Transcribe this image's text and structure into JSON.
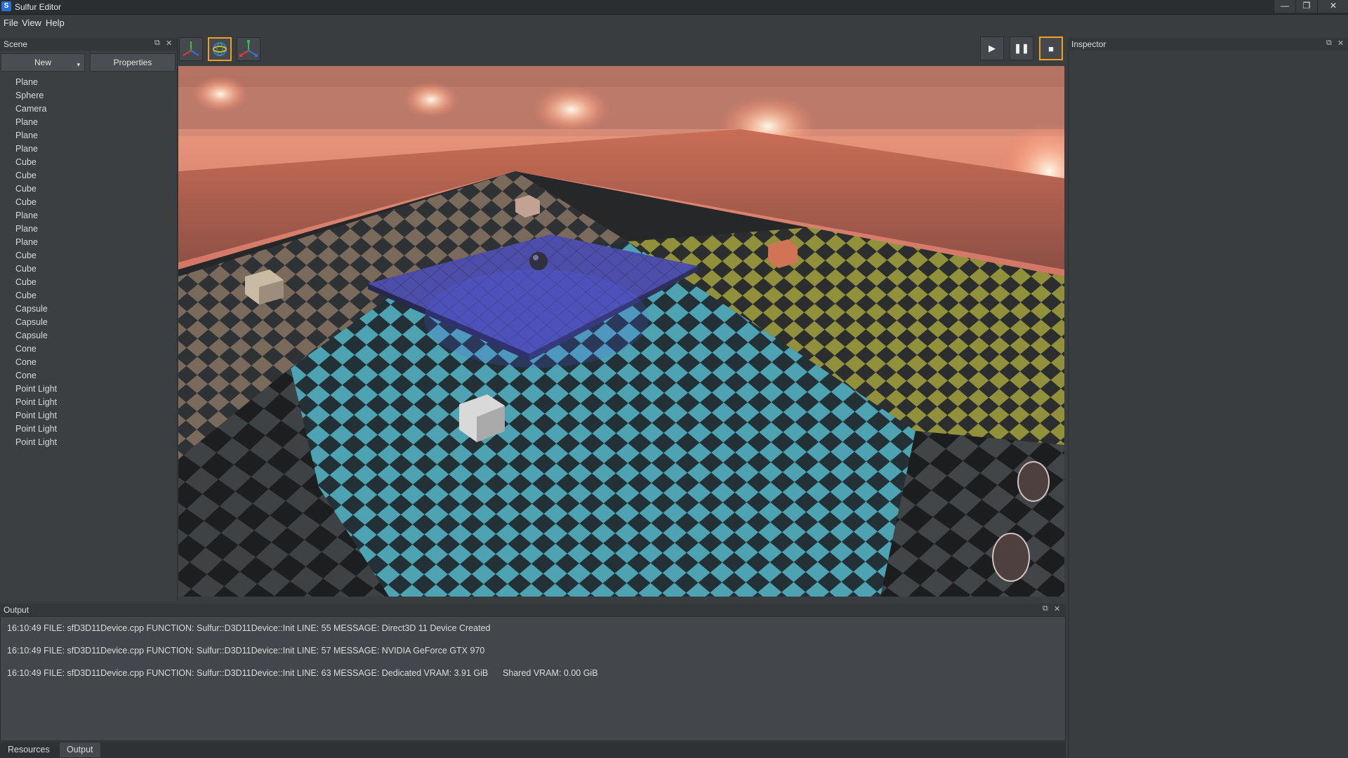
{
  "window": {
    "title": "Sulfur Editor",
    "controls": [
      "minimize",
      "maximize",
      "close"
    ]
  },
  "menu": [
    "File",
    "View",
    "Help"
  ],
  "scene_panel": {
    "title": "Scene",
    "new_button": "New",
    "properties_button": "Properties",
    "items": [
      "Plane",
      "Sphere",
      "Camera",
      "Plane",
      "Plane",
      "Plane",
      "Cube",
      "Cube",
      "Cube",
      "Cube",
      "Plane",
      "Plane",
      "Plane",
      "Cube",
      "Cube",
      "Cube",
      "Cube",
      "Capsule",
      "Capsule",
      "Capsule",
      "Cone",
      "Cone",
      "Cone",
      "Point Light",
      "Point Light",
      "Point Light",
      "Point Light",
      "Point Light"
    ]
  },
  "toolbar": {
    "gizmos": [
      "translate-gizmo",
      "rotate-gizmo",
      "scale-gizmo"
    ],
    "active_gizmo": "rotate-gizmo",
    "playback": [
      "play",
      "pause",
      "stop"
    ],
    "active_playback": "stop",
    "accent_color": "#f0a020"
  },
  "inspector": {
    "title": "Inspector"
  },
  "output": {
    "title": "Output",
    "lines": [
      "16:10:49 FILE: sfD3D11Device.cpp FUNCTION: Sulfur::D3D11Device::Init LINE: 55 MESSAGE: Direct3D 11 Device Created",
      "16:10:49 FILE: sfD3D11Device.cpp FUNCTION: Sulfur::D3D11Device::Init LINE: 57 MESSAGE: NVIDIA GeForce GTX 970",
      "16:10:49 FILE: sfD3D11Device.cpp FUNCTION: Sulfur::D3D11Device::Init LINE: 63 MESSAGE: Dedicated VRAM: 3.91 GiB      Shared VRAM: 0.00 GiB"
    ]
  },
  "bottom_tabs": [
    "Resources",
    "Output"
  ],
  "active_bottom_tab": "Output"
}
